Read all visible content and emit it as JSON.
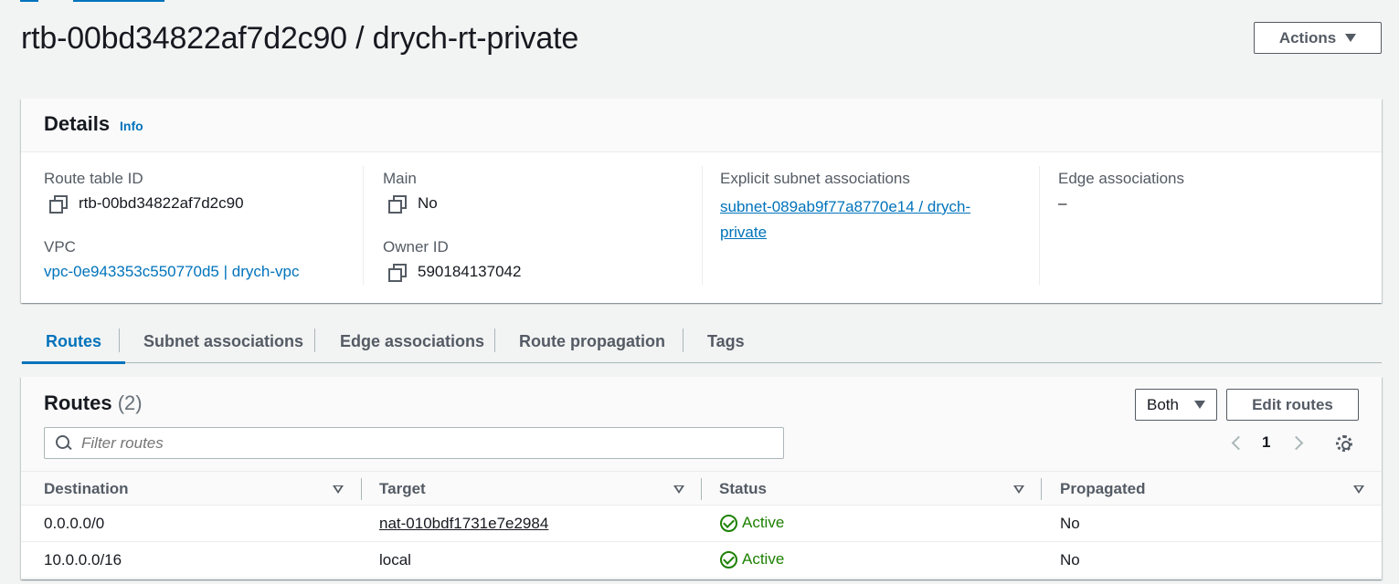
{
  "page": {
    "title": "rtb-00bd34822af7d2c90 / drych-rt-private",
    "actions_label": "Actions"
  },
  "details": {
    "heading": "Details",
    "info_label": "Info",
    "route_table_id_label": "Route table ID",
    "route_table_id": "rtb-00bd34822af7d2c90",
    "main_label": "Main",
    "main_value": "No",
    "explicit_subnet_label": "Explicit subnet associations",
    "explicit_subnet_line1": "subnet-089ab9f77a8770e14 / drych-",
    "explicit_subnet_line2": "private",
    "edge_label": "Edge associations",
    "edge_value": "–",
    "vpc_label": "VPC",
    "vpc_value": "vpc-0e943353c550770d5 | drych-vpc",
    "owner_label": "Owner ID",
    "owner_value": "590184137042"
  },
  "tabs": [
    {
      "label": "Routes",
      "active": true
    },
    {
      "label": "Subnet associations",
      "active": false
    },
    {
      "label": "Edge associations",
      "active": false
    },
    {
      "label": "Route propagation",
      "active": false
    },
    {
      "label": "Tags",
      "active": false
    }
  ],
  "routes": {
    "title": "Routes",
    "count": "(2)",
    "both_label": "Both",
    "edit_label": "Edit routes",
    "filter_placeholder": "Filter routes",
    "page_number": "1",
    "columns": [
      "Destination",
      "Target",
      "Status",
      "Propagated"
    ],
    "rows": [
      {
        "destination": "0.0.0.0/0",
        "target": "nat-010bdf1731e7e2984",
        "target_link": true,
        "status": "Active",
        "propagated": "No"
      },
      {
        "destination": "10.0.0.0/16",
        "target": "local",
        "target_link": false,
        "status": "Active",
        "propagated": "No"
      }
    ]
  },
  "colors": {
    "link": "#0073bb",
    "success": "#1d8102",
    "background": "#f2f3f3"
  }
}
